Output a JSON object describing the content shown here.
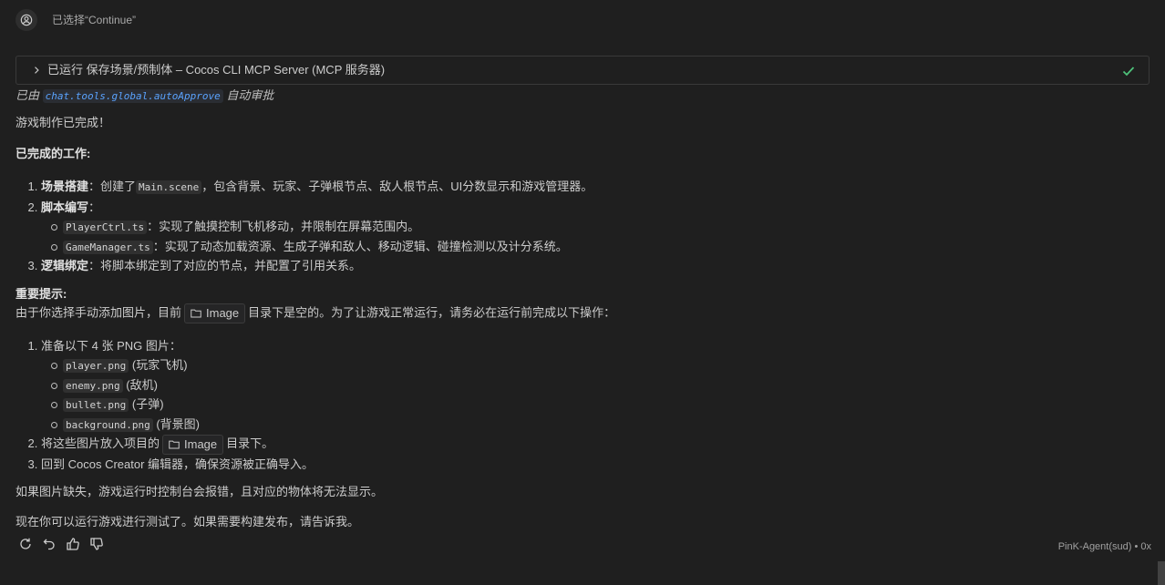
{
  "header": {
    "user_avatar_icon": "person-circle-icon",
    "selected_text": "已选择“Continue”"
  },
  "tool_call": {
    "chevron_icon": "chevron-right-icon",
    "label": "已运行 保存场景/预制体 – Cocos CLI MCP Server (MCP 服务器)",
    "status_icon": "check-icon",
    "status_color": "#4ec27a"
  },
  "approval": {
    "prefix": "已由",
    "setting": "chat.tools.global.autoApprove",
    "suffix": "自动审批"
  },
  "message": {
    "intro": "游戏制作已完成！",
    "done_heading": "已完成的工作:",
    "done_items": [
      {
        "num": "1.",
        "title": "场景搭建",
        "text_a": "：创建了",
        "code": "Main.scene",
        "text_b": "，包含背景、玩家、子弹根节点、敌人根节点、UI分数显示和游戏管理器。"
      },
      {
        "num": "2.",
        "title": "脚本编写",
        "text_a": "：",
        "code": "",
        "text_b": ""
      },
      {
        "num": "3.",
        "title": "逻辑绑定",
        "text_a": "：将脚本绑定到了对应的节点，并配置了引用关系。",
        "code": "",
        "text_b": ""
      }
    ],
    "script_items": [
      {
        "code": "PlayerCtrl.ts",
        "text": "：实现了触摸控制飞机移动，并限制在屏幕范围内。"
      },
      {
        "code": "GameManager.ts",
        "text": "：实现了动态加载资源、生成子弹和敌人、移动逻辑、碰撞检测以及计分系统。"
      }
    ],
    "tip_heading": "重要提示:",
    "tip_text_a": "由于你选择手动添加图片，目前",
    "folder_icon": "folder-icon",
    "folder_name": "Image",
    "tip_text_b": "目录下是空的。为了让游戏正常运行，请务必在运行前完成以下操作：",
    "steps": [
      {
        "num": "1.",
        "text": "准备以下 4 张 PNG 图片："
      },
      {
        "num": "2.",
        "text_a": "将这些图片放入项目的",
        "text_b": "目录下。"
      },
      {
        "num": "3.",
        "text": "回到 Cocos Creator 编辑器，确保资源被正确导入。"
      }
    ],
    "images": [
      {
        "code": "player.png",
        "text": "(玩家飞机)"
      },
      {
        "code": "enemy.png",
        "text": "(敌机)"
      },
      {
        "code": "bullet.png",
        "text": "(子弹)"
      },
      {
        "code": "background.png",
        "text": "(背景图)"
      }
    ],
    "warning": "如果图片缺失，游戏运行时控制台会报错，且对应的物体将无法显示。",
    "closing": "现在你可以运行游戏进行测试了。如果需要构建发布，请告诉我。"
  },
  "footer": {
    "actions": [
      "retry-icon",
      "undo-icon",
      "thumbs-up-icon",
      "thumbs-down-icon"
    ],
    "agent_info": "PinK-Agent(sud) • 0x"
  }
}
